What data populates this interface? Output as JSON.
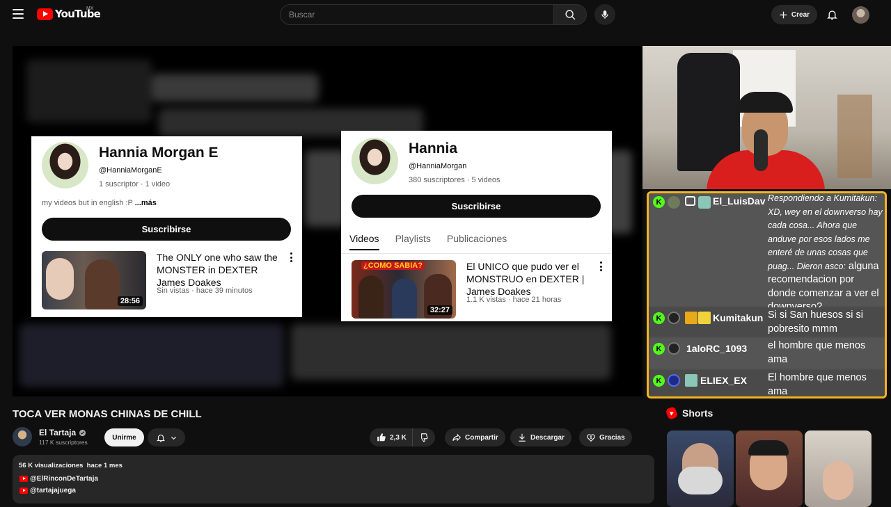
{
  "header": {
    "logo_text": "YouTube",
    "country": "MX",
    "search_placeholder": "Buscar",
    "create_label": "Crear"
  },
  "overlay": {
    "left_card": {
      "name": "Hannia Morgan E",
      "handle": "@HanniaMorganE",
      "meta": "1 suscriptor · 1 video",
      "description": "my videos but in english :P",
      "more": "...más",
      "subscribe": "Suscribirse",
      "video": {
        "title": "The ONLY one who saw the MONSTER in DEXTER James Doakes",
        "meta": "Sin vistas · hace 39 minutos",
        "duration": "28:56"
      }
    },
    "right_card": {
      "name": "Hannia",
      "handle": "@HanniaMorgan",
      "meta": "380 suscriptores · 5 videos",
      "subscribe": "Suscribirse",
      "tabs": [
        "Videos",
        "Playlists",
        "Publicaciones"
      ],
      "video": {
        "title": "El UNICO que pudo ver el MONSTRUO en DEXTER | James Doakes",
        "meta": "1.1 K vistas · hace 21 horas",
        "duration": "32:27",
        "thumb_text": "¿COMO SABIA?"
      }
    }
  },
  "chat": [
    {
      "user": "El_LuisDav",
      "message": "Respondiendo a Kumitakun: XD, wey en el downverso hay cada cosa... Ahora que anduve por esos lados me enteré de unas cosas que puag... Dieron asco:",
      "message_tail": "alguna recomendacion por donde comenzar a ver el downverso?"
    },
    {
      "user": "Kumitakun",
      "message": "Si si San huesos si si pobresito mmm"
    },
    {
      "user": "1aloRC_1093",
      "message": "el hombre que menos ama"
    },
    {
      "user": "ELIEX_EX",
      "message": "El hombre que menos ama"
    }
  ],
  "chat_badge": "K",
  "video": {
    "title": "TOCA VER MONAS CHINAS DE CHILL",
    "channel": "El Tartaja",
    "subscribers": "117 K suscriptores",
    "join": "Unirme",
    "likes": "2,3 K",
    "share": "Compartir",
    "download": "Descargar",
    "thanks": "Gracias"
  },
  "description": {
    "meta": "56 K visualizaciones  hace 1 mes",
    "links": [
      "@ElRinconDeTartaja",
      "@tartajajuega"
    ]
  },
  "shorts": {
    "title": "Shorts"
  },
  "colors": {
    "brand_red": "#ff0000",
    "chat_border": "#f3b41f",
    "kick_green": "#53fc18"
  }
}
